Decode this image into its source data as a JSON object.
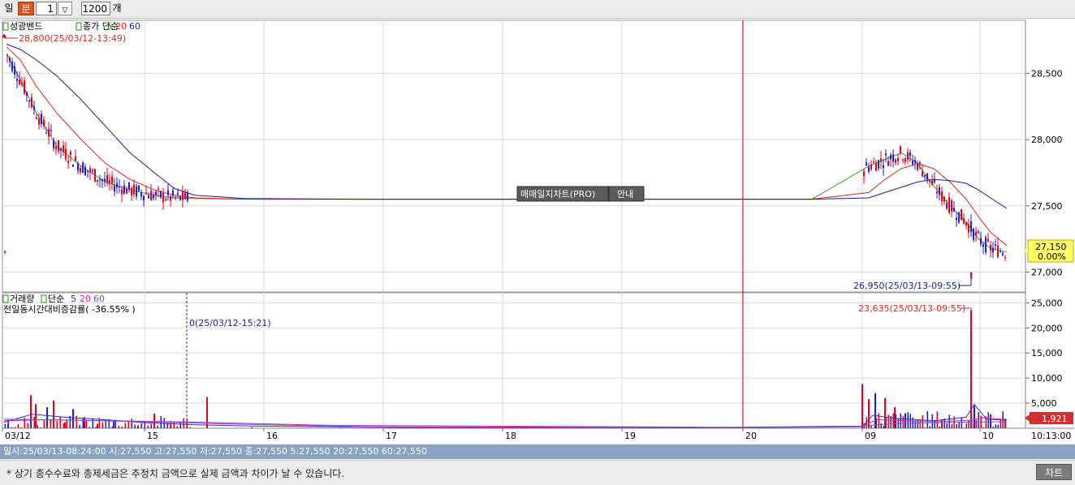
{
  "toolbar": {
    "day_label": "일",
    "minute_label": "분",
    "interval_value": "1",
    "count_value": "1200",
    "count_unit": "개"
  },
  "icons": {
    "spin": "down-arrow-icon",
    "legend_marker": "checkbox-icon"
  },
  "colors": {
    "up": "#e8001c",
    "down": "#1f1fd0",
    "ma5": "#3a9a2c",
    "ma20": "#e0261e",
    "ma60": "#1c1c9c",
    "vol_ma5": "#2f2fcf",
    "vol_ma20": "#e01ea0",
    "vol_ma60": "#6a5acd",
    "status_bg": "#8aa1c1"
  },
  "price_panel": {
    "legend_name": "성광벤드",
    "legend_price_type": "종가 단순",
    "ma_periods": [
      "5",
      "20",
      "60"
    ],
    "high_annotation": "28,800(25/03/12-13:49)",
    "low_annotation": "26,950(25/03/13-09:55)",
    "last_price": "27,150",
    "last_change": "0.00%",
    "center_button_pro": "매매일지차트(PRO)",
    "center_button_guide": "안내"
  },
  "volume_panel": {
    "legend_name": "거래량",
    "legend_type": "단순",
    "ma_periods": [
      "5",
      "20",
      "60"
    ],
    "compare_text": "전일동시간대비증감률( -36.55% )",
    "zero_annotation": "0(25/03/12-15:21)",
    "peak_annotation": "23,635(25/03/13-09:55)",
    "last_volume": "1,921"
  },
  "time_axis": {
    "end_label": "10:13:00"
  },
  "status": {
    "text": "일시:25/03/13-08:24:00 시:27,550 고:27,550 저:27,550 종:27,550 5:27,550 20:27,550 60:27,550"
  },
  "footer": {
    "note": "* 상기 총수수료와 총제세금은 추정치 금액으로  실제 금액과 차이가 날 수 있습니다.",
    "chart_button": "차트"
  },
  "chart_data": [
    {
      "type": "candlestick",
      "title": "",
      "ylim": [
        26850,
        28900
      ],
      "y_ticks": [
        "27,000",
        "27,500",
        "28,000",
        "28,500"
      ],
      "x_ticks": [
        "03/12",
        "15",
        "16",
        "17",
        "18",
        "19",
        "20",
        "09",
        "10"
      ],
      "grid": true,
      "series": [
        {
          "name": "5",
          "values": [
            28650,
            28450,
            28200,
            27950,
            27800,
            27680,
            27620,
            27580,
            27560,
            27555,
            27550,
            27550,
            27550,
            27550,
            27800,
            27850,
            27900,
            27820,
            27650,
            27500,
            27380,
            27250,
            27180,
            27150
          ]
        },
        {
          "name": "20",
          "values": [
            28700,
            28600,
            28400,
            28200,
            28000,
            27820,
            27700,
            27620,
            27580,
            27560,
            27550,
            27550,
            27550,
            27550,
            27600,
            27700,
            27780,
            27820,
            27780,
            27680,
            27550,
            27420,
            27300,
            27200
          ]
        },
        {
          "name": "60",
          "values": [
            28720,
            28680,
            28600,
            28480,
            28300,
            28100,
            27900,
            27750,
            27630,
            27580,
            27555,
            27550,
            27550,
            27550,
            27560,
            27600,
            27640,
            27680,
            27700,
            27690,
            27670,
            27620,
            27560,
            27480
          ]
        }
      ],
      "high": 28800,
      "low": 26950,
      "last": 27150
    },
    {
      "type": "bar",
      "title": "",
      "ylim": [
        0,
        27000
      ],
      "y_ticks": [
        "5,000",
        "10,000",
        "15,000",
        "20,000",
        "25,000"
      ],
      "series": [
        {
          "name": "거래량",
          "values": [
            900,
            6600,
            4800,
            4200,
            5500,
            1200,
            3800,
            2200,
            900,
            1400,
            600,
            2900,
            700,
            6200,
            200,
            0,
            8800,
            5800,
            7000,
            6000,
            4200,
            3000,
            1800,
            23635,
            4500,
            2800,
            1921
          ]
        }
      ],
      "peak": 23635
    }
  ]
}
